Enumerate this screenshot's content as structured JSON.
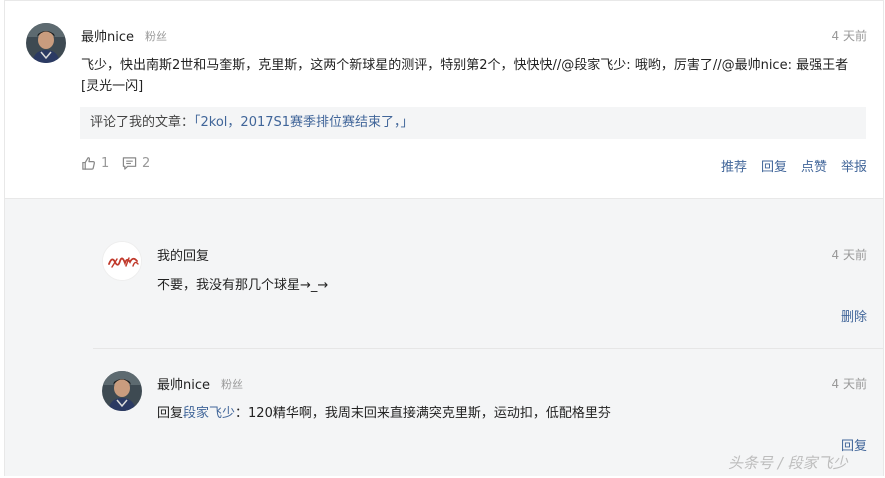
{
  "main_comment": {
    "author": "最帅nice",
    "author_tag": "粉丝",
    "time": "4 天前",
    "text": "飞少，快出南斯2世和马奎斯，克里斯，这两个新球星的测评，特别第2个，快快快//@段家飞少: 哦哟，厉害了//@最帅nice: 最强王者[灵光一闪]",
    "quote_label": "评论了我的文章：",
    "quote_title": "「2kol，2017S1赛季排位赛结束了，」",
    "likes": "1",
    "replies_count": "2",
    "actions": {
      "recommend": "推荐",
      "reply": "回复",
      "like": "点赞",
      "report": "举报"
    }
  },
  "replies": [
    {
      "author": "我的回复",
      "time": "4 天前",
      "text": "不要，我没有那几个球星→_→",
      "action": "删除",
      "avatar_text": "段家飞少"
    },
    {
      "author": "最帅nice",
      "author_tag": "粉丝",
      "time": "4 天前",
      "prefix": "回复",
      "mention": "段家飞少",
      "text": "：120精华啊，我周末回来直接满突克里斯，运动扣，低配格里芬",
      "action": "回复"
    }
  ],
  "watermark": "头条号 / 段家飞少",
  "colors": {
    "link": "#406599",
    "muted": "#999999",
    "reply_bg": "#f4f5f6"
  }
}
